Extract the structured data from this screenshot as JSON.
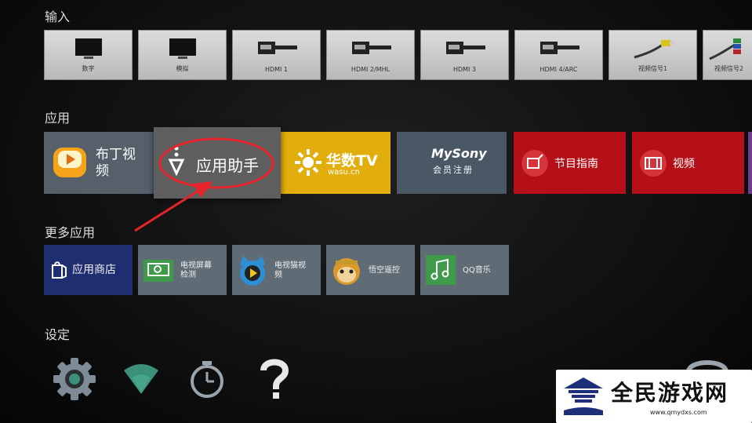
{
  "sections": {
    "input": "输入",
    "apps": "应用",
    "more_apps": "更多应用",
    "settings": "设定"
  },
  "inputs": [
    {
      "label": "数字",
      "icon": "tv-icon"
    },
    {
      "label": "模拟",
      "icon": "tv-icon"
    },
    {
      "label": "HDMI 1",
      "icon": "hdmi-icon"
    },
    {
      "label": "HDMI 2/MHL",
      "icon": "hdmi-icon"
    },
    {
      "label": "HDMI 3",
      "icon": "hdmi-icon"
    },
    {
      "label": "HDMI 4/ARC",
      "icon": "hdmi-icon"
    },
    {
      "label": "视频信号1",
      "icon": "composite-cable-icon"
    },
    {
      "label": "视频信号2",
      "icon": "component-cable-icon"
    }
  ],
  "apps": [
    {
      "label": "布丁视频",
      "line1": "布丁视",
      "line2": "频",
      "color": "#55606b"
    },
    {
      "label": "应用助手",
      "color": "#5e5e5e"
    },
    {
      "label": "华数TV",
      "brand": "华数TV",
      "sub": "wasu.cn",
      "color": "#e2ae0e"
    },
    {
      "label": "MySony",
      "sub": "会员注册",
      "color": "#4a5866"
    },
    {
      "label": "节目指南",
      "color": "#b50f17"
    },
    {
      "label": "视频",
      "color": "#b50f17"
    }
  ],
  "more_apps": [
    {
      "label": "应用商店",
      "color": "#1f2e70"
    },
    {
      "label": "电视屏幕检测",
      "line1": "电视屏幕",
      "line2": "检测",
      "color": "#5f6c76"
    },
    {
      "label": "电视猫视频",
      "line1": "电视猫视",
      "line2": "频",
      "color": "#5f6c76"
    },
    {
      "label": "悟空遥控",
      "color": "#5f6c76"
    },
    {
      "label": "QQ音乐",
      "color": "#5f6c76"
    }
  ],
  "settings_icons": [
    "gear-icon",
    "wifi-icon",
    "timer-icon",
    "help-icon"
  ],
  "watermark": {
    "text": "全民游戏网",
    "url": "www.qmydxs.com"
  },
  "colors": {
    "annotation_red": "#e5232a",
    "highlight_frame": "#5e5e5e"
  }
}
